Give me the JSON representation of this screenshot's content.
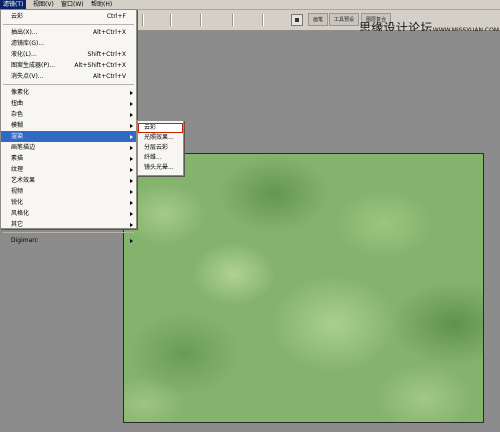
{
  "menubar": {
    "items": [
      "滤镜(T)",
      "视图(V)",
      "窗口(W)",
      "帮助(H)"
    ]
  },
  "toolbar": {
    "tabs": [
      "画笔",
      "工具预设",
      "图层复合"
    ]
  },
  "watermark": {
    "text": "思缘设计论坛",
    "url": "WWW.MISSYUAN.COM"
  },
  "filter_menu": {
    "top_group": [
      {
        "label": "云彩",
        "shortcut": "Ctrl+F"
      }
    ],
    "special_group": [
      {
        "label": "抽出(X)...",
        "shortcut": "Alt+Ctrl+X"
      },
      {
        "label": "滤镜库(G)...",
        "shortcut": ""
      },
      {
        "label": "液化(L)...",
        "shortcut": "Shift+Ctrl+X"
      },
      {
        "label": "图案生成器(P)...",
        "shortcut": "Alt+Shift+Ctrl+X"
      },
      {
        "label": "消失点(V)...",
        "shortcut": "Alt+Ctrl+V"
      }
    ],
    "filters_group_a": [
      "像素化",
      "扭曲",
      "杂色",
      "模糊"
    ],
    "selected_item": "渲染",
    "filters_group_b": [
      "画笔描边",
      "素描",
      "纹理",
      "艺术效果",
      "视频",
      "锐化",
      "风格化",
      "其它"
    ],
    "bottom_group": [
      "Digimarc"
    ]
  },
  "render_submenu": {
    "items": [
      "云彩",
      "光照效果...",
      "分层云彩",
      "纤维...",
      "镜头光晕..."
    ],
    "hovered_index": 0
  }
}
